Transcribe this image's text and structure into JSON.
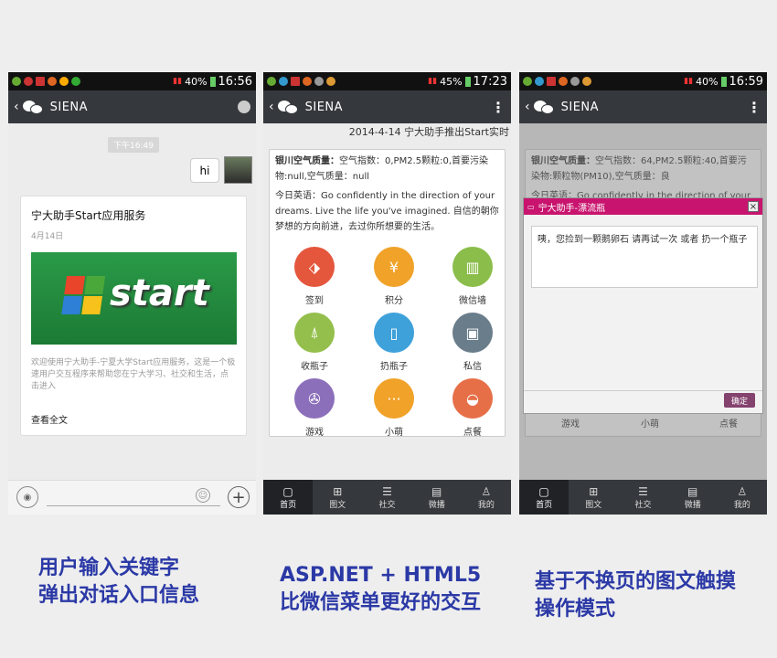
{
  "phone1": {
    "time": "16:56",
    "battery": "40%",
    "title": "SIENA",
    "timestamp": "下午16:49",
    "bubble": "hi",
    "card": {
      "title": "宁大助手Start应用服务",
      "date": "4月14日",
      "banner_text": "start",
      "desc": "欢迎使用宁大助手-宁夏大学Start应用服务，这是一个极速用户交互程序来帮助您在宁大学习、社交和生活，点击进入",
      "more": "查看全文"
    }
  },
  "phone2": {
    "time": "17:23",
    "battery": "45%",
    "title": "SIENA",
    "marquee": "2014-4-14 宁大助手推出Start实时",
    "air_label": "银川空气质量：",
    "air_text": "空气指数：0,PM2.5颗粒:0,首要污染物:null,空气质量：null",
    "eng_label": "今日英语：",
    "eng_text": "Go confidently in the direction of your dreams. Live the life you've imagined. 自信的朝你梦想的方向前进，去过你所想要的生活。",
    "icons": [
      {
        "label": "签到",
        "icon": "tag-icon",
        "color": "#e4573d"
      },
      {
        "label": "积分",
        "icon": "yuan-icon",
        "color": "#f0a229"
      },
      {
        "label": "微信墙",
        "icon": "building-icon",
        "color": "#8bbd4a"
      },
      {
        "label": "收瓶子",
        "icon": "tower-icon",
        "color": "#94bf4c"
      },
      {
        "label": "扔瓶子",
        "icon": "bottle-icon",
        "color": "#3ea1da"
      },
      {
        "label": "私信",
        "icon": "bus-icon",
        "color": "#6a7d8a"
      },
      {
        "label": "游戏",
        "icon": "film-icon",
        "color": "#8c6fba"
      },
      {
        "label": "小萌",
        "icon": "dots-icon",
        "color": "#f0a229"
      },
      {
        "label": "点餐",
        "icon": "bowl-icon",
        "color": "#e66f48"
      }
    ]
  },
  "phone3": {
    "time": "16:59",
    "battery": "40%",
    "title": "SIENA",
    "air_label": "银川空气质量：",
    "air_text": "空气指数：64,PM2.5颗粒:40,首要污染物:颗粒物(PM10),空气质量：良",
    "eng_peek": "今日英语：Go confidently in the direction of your",
    "dialog_title": "宁大助手-漂流瓶",
    "dialog_msg": "咦，您捡到一颗鹅卵石 请再试一次 或者 扔一个瓶子",
    "dialog_ok": "确定",
    "bottom_labels": [
      "游戏",
      "小萌",
      "点餐"
    ]
  },
  "tabs": [
    "首页",
    "图文",
    "社交",
    "微播",
    "我的"
  ],
  "captions": {
    "c1_line1": "用户输入关键字",
    "c1_line2": "弹出对话入口信息",
    "c2_line1": "ASP.NET + HTML5",
    "c2_line2": "比微信菜单更好的交互",
    "c3_line1": "基于不换页的图文触摸",
    "c3_line2": "操作模式"
  }
}
